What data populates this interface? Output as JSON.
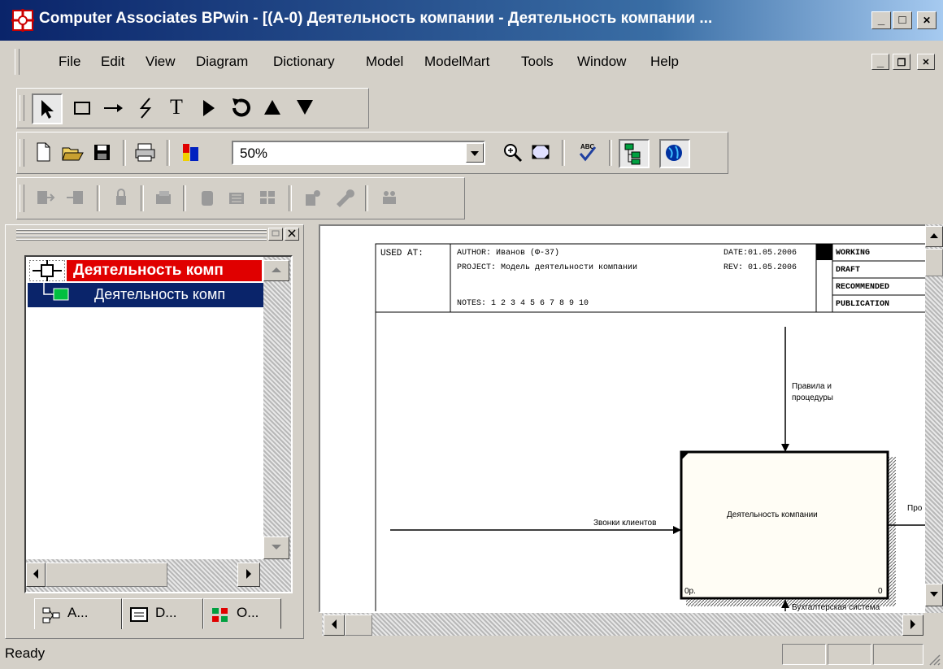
{
  "window": {
    "title": "Computer Associates BPwin - [(A-0) Деятельность компании - Деятельность компании ...",
    "min_label": "_",
    "max_label": "□",
    "close_label": "✕",
    "child_min_label": "_",
    "child_restore_label": "❐",
    "child_close_label": "✕"
  },
  "menu": {
    "items": [
      {
        "label": "File",
        "key": "F"
      },
      {
        "label": "Edit",
        "key": "E"
      },
      {
        "label": "View",
        "key": "V"
      },
      {
        "label": "Diagram",
        "key": "D"
      },
      {
        "label": "Dictionary",
        "key": "c"
      },
      {
        "label": "Model",
        "key": "o"
      },
      {
        "label": "ModelMart",
        "key": "M"
      },
      {
        "label": "Tools",
        "key": "T"
      },
      {
        "label": "Window",
        "key": "W"
      },
      {
        "label": "Help",
        "key": "H"
      }
    ]
  },
  "toolbar": {
    "zoom_value": "50%",
    "text_tool_label": "T",
    "spell_label": "ABC"
  },
  "tree": {
    "root_label": "Деятельность комп",
    "child_label": "Деятельность комп"
  },
  "tabs": [
    {
      "label": "A...",
      "icon": "activity-tree-icon"
    },
    {
      "label": "D...",
      "icon": "diagram-list-icon"
    },
    {
      "label": "O...",
      "icon": "objects-icon"
    }
  ],
  "diagram": {
    "frame": {
      "used_at": "USED AT:",
      "author": "AUTHOR: Иванов (Ф-37)",
      "project": "PROJECT: Модель деятельности компании",
      "notes": "NOTES: 1 2 3 4 5 6 7 8 9 10",
      "date": "DATE:01.05.2006",
      "rev": "REV: 01.05.2006",
      "status_working": "WORKING",
      "status_draft": "DRAFT",
      "status_recommended": "RECOMMENDED",
      "status_publication": "PUBLICATION"
    },
    "activity_label": "Деятельность компании",
    "activity_node": "0р.",
    "activity_number": "0",
    "control_label_1": "Правила и",
    "control_label_2": "процедуры",
    "input_label": "Звонки клиентов",
    "output_label": "Про",
    "mechanism_label": "Бухгалтерская система"
  },
  "status": {
    "text": "Ready"
  }
}
